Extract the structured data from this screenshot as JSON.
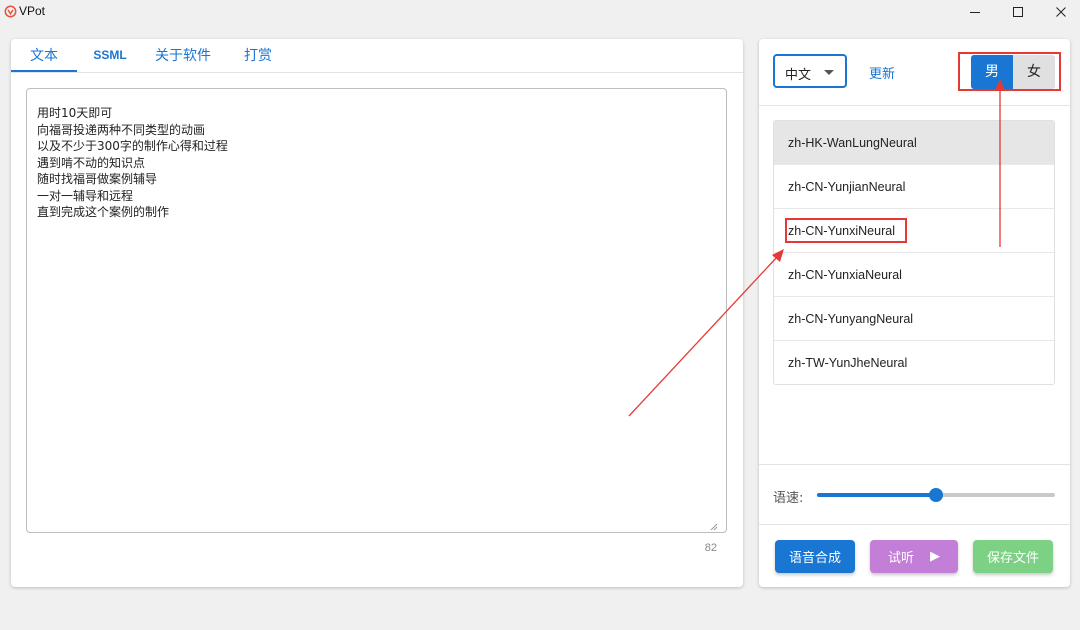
{
  "window": {
    "title": "VPot"
  },
  "tabs": [
    {
      "label": "文本"
    },
    {
      "label": "SSML"
    },
    {
      "label": "关于软件"
    },
    {
      "label": "打赏"
    }
  ],
  "editor": {
    "text": "用时10天即可\n向福哥投递两种不同类型的动画\n以及不少于300字的制作心得和过程\n遇到啃不动的知识点\n随时找福哥做案例辅导\n一对一辅导和远程\n直到完成这个案例的制作",
    "char_count": "82"
  },
  "voice_panel": {
    "language": "中文",
    "refresh_label": "更新",
    "gender": {
      "male": "男",
      "female": "女",
      "selected": "男"
    },
    "voices": [
      "zh-HK-WanLungNeural",
      "zh-CN-YunjianNeural",
      "zh-CN-YunxiNeural",
      "zh-CN-YunxiaNeural",
      "zh-CN-YunyangNeural",
      "zh-TW-YunJheNeural"
    ],
    "selected_voice": "zh-HK-WanLungNeural",
    "highlighted_voice": "zh-CN-YunxiNeural"
  },
  "speed": {
    "label": "语速:",
    "value_fraction": 0.5
  },
  "actions": {
    "synthesize": "语音合成",
    "listen": "试听",
    "save": "保存文件"
  },
  "colors": {
    "accent": "#1976d2",
    "listen_button": "#c37fd8",
    "save_button": "#7cd184",
    "annotation": "#e53935"
  }
}
